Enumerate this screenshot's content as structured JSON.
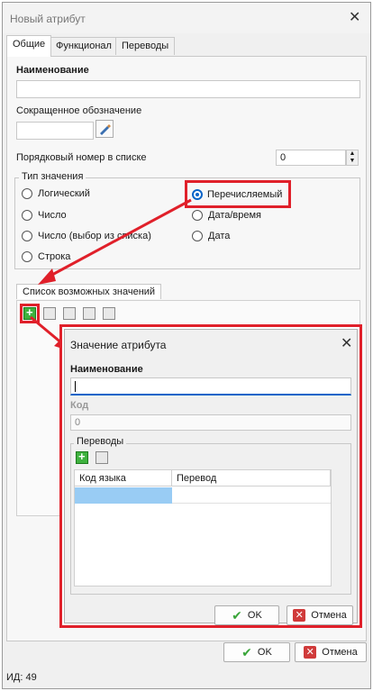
{
  "window": {
    "title": "Новый атрибут",
    "close": "✕"
  },
  "tabs": [
    {
      "label": "Общие",
      "active": true
    },
    {
      "label": "Функционал",
      "active": false
    },
    {
      "label": "Переводы",
      "active": false
    }
  ],
  "general": {
    "name_label": "Наименование",
    "name_value": "",
    "short_label": "Сокращенное обозначение",
    "short_value": "",
    "order_label": "Порядковый номер в списке",
    "order_value": "0",
    "value_type": {
      "legend": "Тип значения",
      "options": [
        {
          "label": "Логический",
          "selected": false
        },
        {
          "label": "Число",
          "selected": false
        },
        {
          "label": "Число (выбор из списка)",
          "selected": false
        },
        {
          "label": "Строка",
          "selected": false
        },
        {
          "label": "Перечисляемый",
          "selected": true
        },
        {
          "label": "Дата/время",
          "selected": false
        },
        {
          "label": "Дата",
          "selected": false
        }
      ]
    },
    "values_list_tab": "Список возможных значений"
  },
  "footer": {
    "ok": "OK",
    "cancel": "Отмена",
    "id_text": "ИД: 49"
  },
  "dialog": {
    "title": "Значение атрибута",
    "close": "✕",
    "name_label": "Наименование",
    "name_value": "",
    "code_label": "Код",
    "code_value": "0",
    "translations_legend": "Переводы",
    "columns": [
      "Код языка",
      "Перевод"
    ],
    "ok": "OK",
    "cancel": "Отмена"
  },
  "colors": {
    "highlight": "#e0202a",
    "accent": "#0a64c8",
    "selection": "#99ccf4"
  }
}
